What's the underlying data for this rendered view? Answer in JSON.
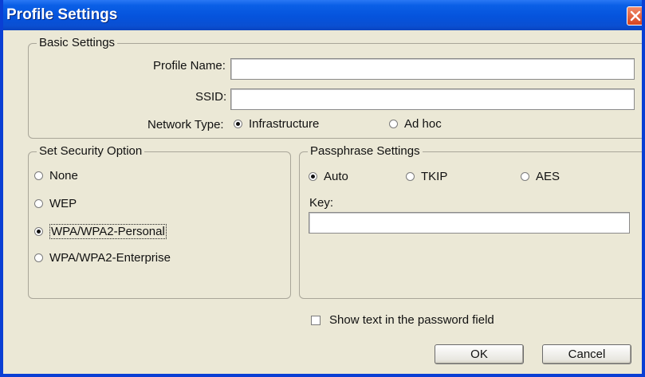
{
  "window": {
    "title": "Profile Settings",
    "close_icon": "close-x-icon"
  },
  "basic_settings": {
    "legend": "Basic Settings",
    "profile_name_label": "Profile Name:",
    "profile_name_value": "",
    "ssid_label": "SSID:",
    "ssid_value": "",
    "network_type_label": "Network Type:",
    "network_type_options": [
      {
        "label": "Infrastructure",
        "selected": true
      },
      {
        "label": "Ad hoc",
        "selected": false
      }
    ]
  },
  "security": {
    "legend": "Set Security Option",
    "options": [
      {
        "label": "None",
        "selected": false
      },
      {
        "label": "WEP",
        "selected": false
      },
      {
        "label": "WPA/WPA2-Personal",
        "selected": true
      },
      {
        "label": "WPA/WPA2-Enterprise",
        "selected": false
      }
    ]
  },
  "passphrase": {
    "legend": "Passphrase Settings",
    "cipher_options": [
      {
        "label": "Auto",
        "selected": true
      },
      {
        "label": "TKIP",
        "selected": false
      },
      {
        "label": "AES",
        "selected": false
      }
    ],
    "key_label": "Key:",
    "key_value": ""
  },
  "show_text": {
    "label": "Show text in the password field",
    "checked": false
  },
  "buttons": {
    "ok": "OK",
    "cancel": "Cancel"
  },
  "colors": {
    "titlebar": "#0553dc",
    "dialog_bg": "#ebe8d6",
    "close_button": "#d8441e"
  }
}
